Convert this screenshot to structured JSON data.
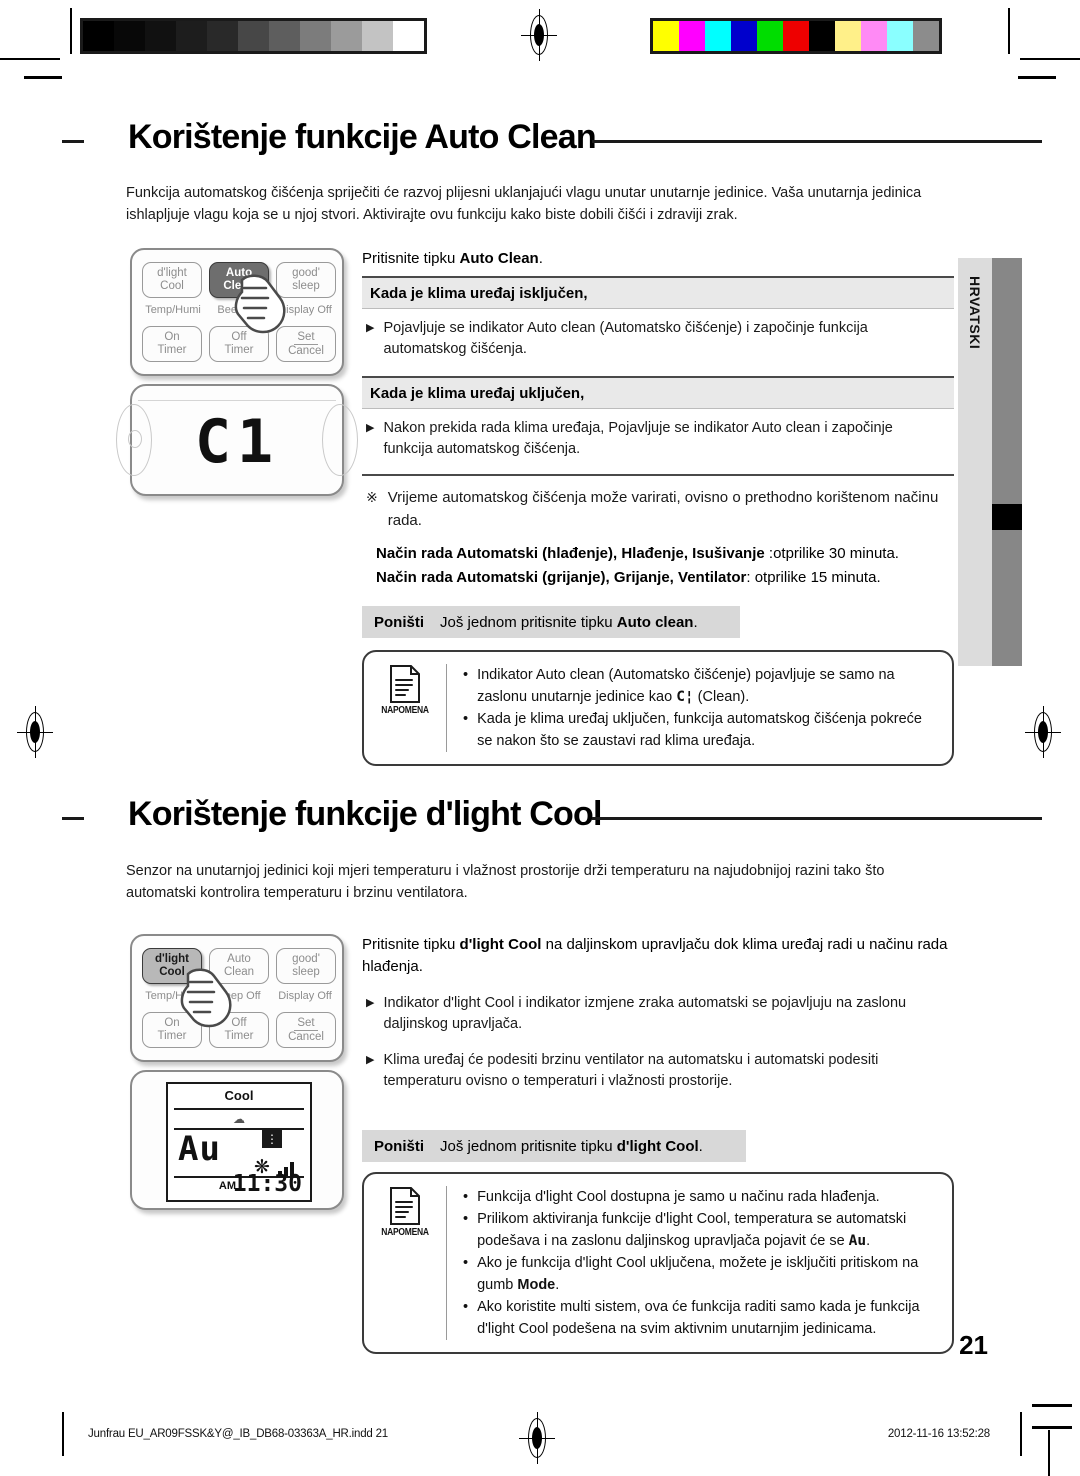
{
  "calibration": {
    "greyscale_swatches": [
      "#000000",
      "#080808",
      "#111111",
      "#1d1d1d",
      "#292929",
      "#474747",
      "#5e5e5e",
      "#7c7c7c",
      "#9b9b9b",
      "#c3c3c3",
      "#ffffff"
    ],
    "color_swatches": [
      "#ffff00",
      "#ff00ff",
      "#00ffff",
      "#0000cc",
      "#00dd00",
      "#ee0000",
      "#000000",
      "#fff089",
      "#ff8af5",
      "#8affff",
      "#8c8c8c"
    ]
  },
  "language_tab": {
    "label": "HRVATSKI"
  },
  "sections": [
    {
      "title": "Korištenje funkcije Auto Clean",
      "intro": "Funkcija automatskog čišćenja spriječiti će razvoj plijesni uklanjajući vlagu unutar unutarnje jedinice. Vaša unutarnja jedinica ishlapljuje vlagu koja se u njoj stvori. Aktivirajte ovu funkciju kako biste dobili čišći i zdraviji zrak.",
      "remote": {
        "buttons_row1": [
          "d'light\nCool",
          "Auto\nClean",
          "good'\nsleep"
        ],
        "active_button": "Auto Clean",
        "sublabels": [
          "Temp/Humi",
          "Beep Off",
          "Display Off"
        ],
        "buttons_row2": [
          "On\nTimer",
          "Off\nTimer",
          "Set\nCancel"
        ]
      },
      "display": {
        "value": "C1",
        "type": "seven-segment"
      },
      "lead": {
        "prefix": "Pritisnite tipku ",
        "bold": "Auto Clean",
        "suffix": "."
      },
      "blocks": [
        {
          "heading": "Kada je klima uređaj isključen,",
          "bullet": "Pojavljuje se indikator Auto clean (Automatsko čišćenje) i započinje funkcija automatskog čišćenja."
        },
        {
          "heading": "Kada je klima uređaj uključen,",
          "bullet": "Nakon prekida rada klima uređaja, Pojavljuje se indikator Auto clean i započinje funkcija automatskog čišćenja."
        }
      ],
      "star_note": "Vrijeme automatskog čišćenja može varirati, ovisno o prethodno korištenom načinu rada.",
      "mode_times": [
        {
          "bold": "Način rada Automatski (hlađenje), Hlađenje, Isušivanje ",
          "regular": ":otprilike 30 minuta."
        },
        {
          "bold": "Način rada Automatski (grijanje), Grijanje, Ventilator",
          "regular": ": otprilike 15 minuta."
        }
      ],
      "cancel": {
        "label": "Poništi",
        "prefix": "Još jednom pritisnite tipku ",
        "bold": "Auto clean",
        "suffix": "."
      },
      "note": {
        "badge": "NAPOMENA",
        "items": [
          {
            "prefix": "Indikator Auto clean (Automatsko čišćenje) pojavljuje se samo na zaslonu unutarnje jedinice kao ",
            "glyph": "C¦",
            "suffix": " (Clean)."
          },
          {
            "prefix": "Kada je klima uređaj uključen, funkcija automatskog čišćenja pokreće se nakon što se zaustavi rad klima uređaja.",
            "glyph": "",
            "suffix": ""
          }
        ]
      }
    },
    {
      "title": "Korištenje funkcije d'light Cool",
      "intro": "Senzor na unutarnjoj jedinici koji mjeri temperaturu i vlažnost prostorije drži temperaturu na najudobnijoj razini tako što automatski kontrolira temperaturu i brzinu ventilatora.",
      "remote": {
        "buttons_row1": [
          "d'light\nCool",
          "Auto\nClean",
          "good'\nsleep"
        ],
        "active_button": "d'light Cool",
        "sublabels": [
          "Temp/Humi",
          "Beep Off",
          "Display Off"
        ],
        "buttons_row2": [
          "On\nTimer",
          "Off\nTimer",
          "Set\nCancel"
        ]
      },
      "display": {
        "mode": "Cool",
        "value": "Au",
        "time": "11:30",
        "ampm": "AM",
        "fan": "auto",
        "fan_bars": 3
      },
      "lead": {
        "prefix": "Pritisnite tipku ",
        "bold": "d'light Cool",
        "suffix": " na daljinskom upravljaču dok klima uređaj radi u načinu rada hlađenja."
      },
      "bullets": [
        "Indikator d'light Cool i indikator izmjene zraka automatski se pojavljuju na zaslonu daljinskog upravljača.",
        "Klima uređaj će podesiti brzinu ventilator na automatsku i automatski podesiti temperaturu ovisno o temperaturi i vlažnosti prostorije."
      ],
      "cancel": {
        "label": "Poništi",
        "prefix": "Još jednom pritisnite tipku ",
        "bold": "d'light Cool",
        "suffix": "."
      },
      "note": {
        "badge": "NAPOMENA",
        "items": [
          {
            "prefix": "Funkcija d'light Cool dostupna je samo u načinu rada hlađenja.",
            "glyph": "",
            "suffix": ""
          },
          {
            "prefix": "Prilikom aktiviranja funkcije d'light Cool, temperatura se automatski podešava i na zaslonu daljinskog upravljača pojavit će se ",
            "glyph": "Au",
            "suffix": "."
          },
          {
            "prefix": "Ako je funkcija d'light Cool uključena, možete je isključiti pritiskom na gumb ",
            "bold": "Mode",
            "suffix": "."
          },
          {
            "prefix": "Ako koristite multi sistem, ova će funkcija raditi samo kada je funkcija d'light Cool podešena na svim aktivnim unutarnjim jedinicama.",
            "glyph": "",
            "suffix": ""
          }
        ]
      }
    }
  ],
  "page_number": "21",
  "footer": {
    "left": "Junfrau EU_AR09FSSK&Y@_IB_DB68-03363A_HR.indd   21",
    "right": "2012-11-16   13:52:28"
  }
}
